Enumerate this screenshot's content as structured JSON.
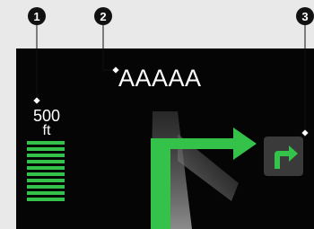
{
  "callouts": [
    "1",
    "2",
    "3"
  ],
  "guidance": {
    "street_name": "AAAAA",
    "distance_value": "500",
    "distance_unit": "ft",
    "distance_bar_count": 10,
    "next_turn_icon": "turn-right-arrow-icon",
    "lane_icon": "lane-guidance-arrow-icon"
  },
  "colors": {
    "screen_bg": "#050505",
    "accent_green": "#34c24a",
    "road_gray": "#7a7a7a"
  }
}
